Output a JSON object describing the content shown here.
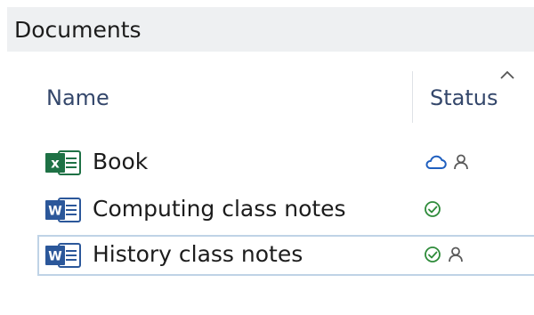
{
  "window": {
    "title": "Documents"
  },
  "columns": {
    "name_label": "Name",
    "status_label": "Status",
    "sort_icon": "chevron-up-icon"
  },
  "files": [
    {
      "name": "Book",
      "type": "excel",
      "type_icon": "excel-file-icon",
      "status_icons": [
        "cloud-icon",
        "person-icon"
      ],
      "selected": false
    },
    {
      "name": "Computing class notes",
      "type": "word",
      "type_icon": "word-file-icon",
      "status_icons": [
        "check-circle-icon"
      ],
      "selected": false
    },
    {
      "name": "History class notes",
      "type": "word",
      "type_icon": "word-file-icon",
      "status_icons": [
        "check-circle-icon",
        "person-icon"
      ],
      "selected": true
    }
  ],
  "colors": {
    "excel_green": "#1e7145",
    "word_blue": "#2b579a",
    "cloud_blue": "#1f5fbf",
    "check_green": "#2e8b3a",
    "person_gray": "#5a5a5a",
    "selection_border": "#bfd3e6",
    "header_text": "#34476b"
  }
}
